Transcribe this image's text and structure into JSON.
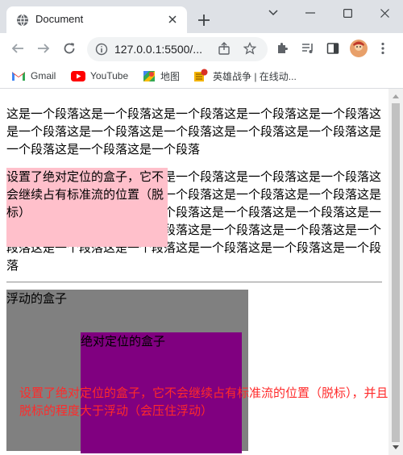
{
  "browser": {
    "tab_title": "Document",
    "url": "127.0.0.1:5500/...",
    "bookmarks": [
      {
        "label": "Gmail",
        "icon": "gmail-icon"
      },
      {
        "label": "YouTube",
        "icon": "youtube-icon"
      },
      {
        "label": "地图",
        "icon": "maps-icon"
      },
      {
        "label": "英雄战争 | 在线动...",
        "icon": "game-icon"
      }
    ]
  },
  "page": {
    "paragraph_1": "这是一个段落这是一个段落这是一个段落这是一个段落这是一个段落这是一个段落这是一个段落这是一个段落这是一个段落这是一个段落这是一个段落这是一个段落这是一个段落",
    "paragraph_2": "这是一个段落这是一个段落这是一个段落这是一个段落这是一个段落这是一个段落这是一个段落这是一个段落这是一个段落这是一个段落这是一个段落这是一个段落这是一个段落这是一个段落这是一个段落这是一个段落这是一个段落这是一个段落这是一个段落这是一个段落这是一个段落这是一个段落这是一个段落这是一个段落这是一个段落这是一个段落",
    "abs_box_1_text": "设置了绝对定位的盒子，它不会继续占有标准流的位置（脱标）",
    "float_box_text": "浮动的盒子",
    "abs_box_2_text": "绝对定位的盒子",
    "note_text": "设置了绝对定位的盒子，它不会继续占有标准流的位置（脱标），并且脱标的程度大于浮动（会压住浮动）"
  },
  "colors": {
    "pink_box": "#ffc0cb",
    "float_box": "#808080",
    "purple_box": "#800080",
    "note_red": "#ff2a2a"
  }
}
